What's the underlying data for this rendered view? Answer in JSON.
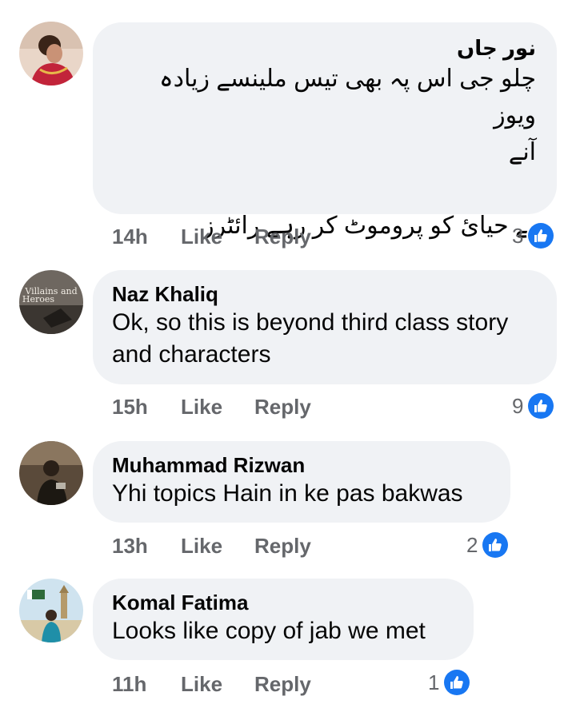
{
  "comments": [
    {
      "author": "نور جاں",
      "text_lines": [
        "چلو جی اس پہ بھی تیس ملینسے زیادہ ویوز",
        "آنے",
        "",
        "بے حیائ کو پروموٹ کر رہے رائٹرز"
      ],
      "time": "14h",
      "like_label": "Like",
      "reply_label": "Reply",
      "reactions": "3",
      "avatar_icon": "woman-bride-avatar"
    },
    {
      "author": "Naz Khaliq",
      "text": "Ok, so this is beyond third class story and characters",
      "time": "15h",
      "like_label": "Like",
      "reply_label": "Reply",
      "reactions": "9",
      "avatar_text": "Villains and Heroes"
    },
    {
      "author": "Muhammad Rizwan",
      "text": "Yhi topics Hain in ke pas bakwas",
      "time": "13h",
      "like_label": "Like",
      "reply_label": "Reply",
      "reactions": "2",
      "avatar_icon": "man-photo-avatar"
    },
    {
      "author": "Komal Fatima",
      "text": "Looks like copy of jab we met",
      "time": "11h",
      "like_label": "Like",
      "reply_label": "Reply",
      "reactions": "1",
      "avatar_icon": "woman-monument-avatar"
    }
  ],
  "colors": {
    "bubble": "#f0f2f5",
    "meta_text": "#65676b",
    "like_blue": "#1877f2"
  }
}
